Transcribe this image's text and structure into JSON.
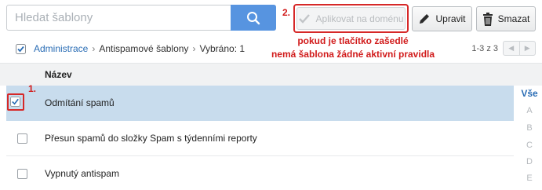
{
  "search": {
    "placeholder": "Hledat šablony"
  },
  "annotations": {
    "marker1": "1.",
    "marker2": "2.",
    "note_line1": "pokud je tlačítko zašedlé",
    "note_line2": "nemá šablona žádné aktivní pravidla"
  },
  "toolbar": {
    "apply_label": "Aplikovat na doménu",
    "edit_label": "Upravit",
    "delete_label": "Smazat"
  },
  "breadcrumb": {
    "root": "Administrace",
    "current": "Antispamové šablony",
    "selected": "Vybráno: 1"
  },
  "pagination": {
    "range": "1-3 z 3"
  },
  "table": {
    "column_name": "Název",
    "rows": [
      {
        "label": "Odmítání spamů",
        "checked": true
      },
      {
        "label": "Přesun spamů do složky Spam s týdenními reporty",
        "checked": false
      },
      {
        "label": "Vypnutý antispam",
        "checked": false
      }
    ]
  },
  "alphabet": {
    "all": "Vše",
    "letters": [
      "A",
      "B",
      "C",
      "D",
      "E"
    ]
  },
  "colors": {
    "accent": "#5794e0",
    "link": "#2a6db5",
    "annotation": "#d11b1b",
    "selected_row": "#c8dced"
  },
  "icons": {
    "search": "search-icon",
    "apply": "checkmark-icon",
    "edit": "pencil-icon",
    "delete": "trash-icon",
    "breadcrumb_checkbox": "checkbox-checked-icon",
    "prev": "chevron-left-icon",
    "next": "chevron-right-icon"
  }
}
